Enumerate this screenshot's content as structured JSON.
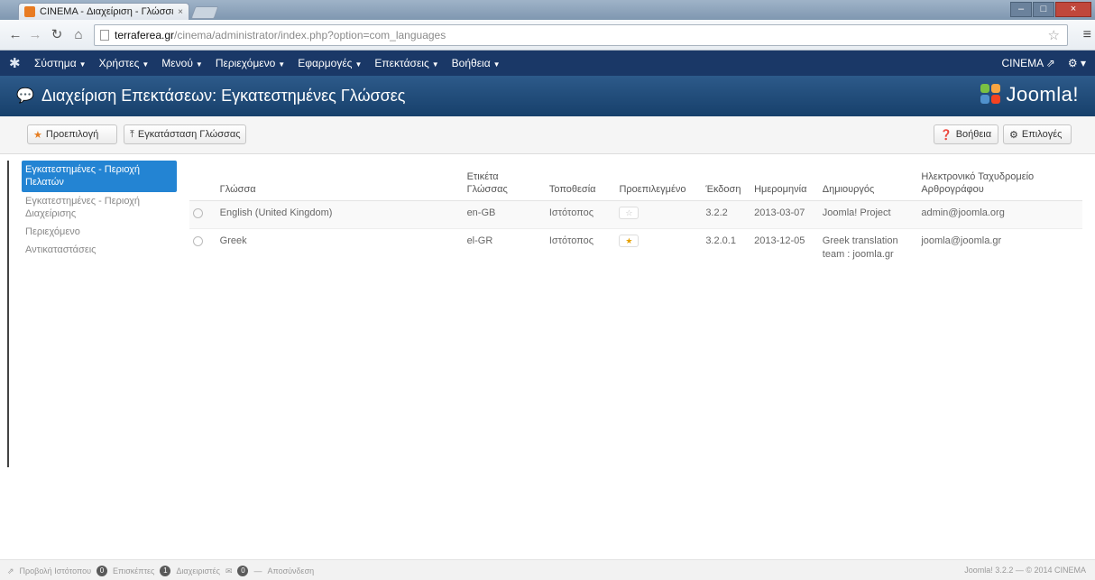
{
  "browser": {
    "tab_title": "CINEMA - Διαχείριση - Γλώσσες",
    "tab_close": "×",
    "url_host": "terraferea.gr",
    "url_path": "/cinema/administrator/index.php?option=com_languages",
    "window_controls": {
      "minimize": "–",
      "maximize": "□",
      "close": "×"
    }
  },
  "navbar": {
    "items": [
      {
        "label": "Σύστημα"
      },
      {
        "label": "Χρήστες"
      },
      {
        "label": "Μενού"
      },
      {
        "label": "Περιεχόμενο"
      },
      {
        "label": "Εφαρμογές"
      },
      {
        "label": "Επεκτάσεις"
      },
      {
        "label": "Βοήθεια"
      }
    ],
    "site_label": "CINEMA ⇗",
    "gear_label": "⚙ ▾"
  },
  "header": {
    "title": "Διαχείριση Επεκτάσεων: Εγκατεστημένες Γλώσσες",
    "logo_text": "Joomla!"
  },
  "toolbar": {
    "default_label": "Προεπιλογή",
    "install_label": "Εγκατάσταση Γλώσσας",
    "help_label": "Βοήθεια",
    "options_label": "Επιλογές"
  },
  "sidebar": {
    "items": [
      {
        "label": "Εγκατεστημένες - Περιοχή Πελατών",
        "active": true
      },
      {
        "label": "Εγκατεστημένες - Περιοχή Διαχείρισης",
        "active": false
      },
      {
        "label": "Περιεχόμενο",
        "active": false
      },
      {
        "label": "Αντικαταστάσεις",
        "active": false
      }
    ]
  },
  "table": {
    "headers": {
      "language": "Γλώσσα",
      "tag": "Ετικέτα Γλώσσας",
      "location": "Τοποθεσία",
      "default": "Προεπιλεγμένο",
      "version": "Έκδοση",
      "date": "Ημερομηνία",
      "author": "Δημιουργός",
      "email": "Ηλεκτρονικό Ταχυδρομείο Αρθρογράφου"
    },
    "rows": [
      {
        "language": "English (United Kingdom)",
        "tag": "en-GB",
        "location": "Ιστότοπος",
        "default_icon": "☆",
        "version": "3.2.2",
        "date": "2013-03-07",
        "author": "Joomla! Project",
        "email": "admin@joomla.org"
      },
      {
        "language": "Greek",
        "tag": "el-GR",
        "location": "Ιστότοπος",
        "default_icon": "★",
        "version": "3.2.0.1",
        "date": "2013-12-05",
        "author": "Greek translation team : joomla.gr",
        "email": "joomla@joomla.gr"
      }
    ]
  },
  "status": {
    "view_site": "Προβολή Ιστότοπου",
    "visitors_count": "0",
    "visitors_label": "Επισκέπτες",
    "admins_count": "1",
    "admins_label": "Διαχειριστές",
    "messages_count": "0",
    "logout_label": "Αποσύνδεση",
    "footer_right": "Joomla! 3.2.2 — © 2014 CINEMA"
  },
  "colors": {
    "navbar_bg": "#1a3867",
    "header_bg": "#17406b",
    "sidebar_active": "#2384d3",
    "default_star": "#e6a000"
  }
}
